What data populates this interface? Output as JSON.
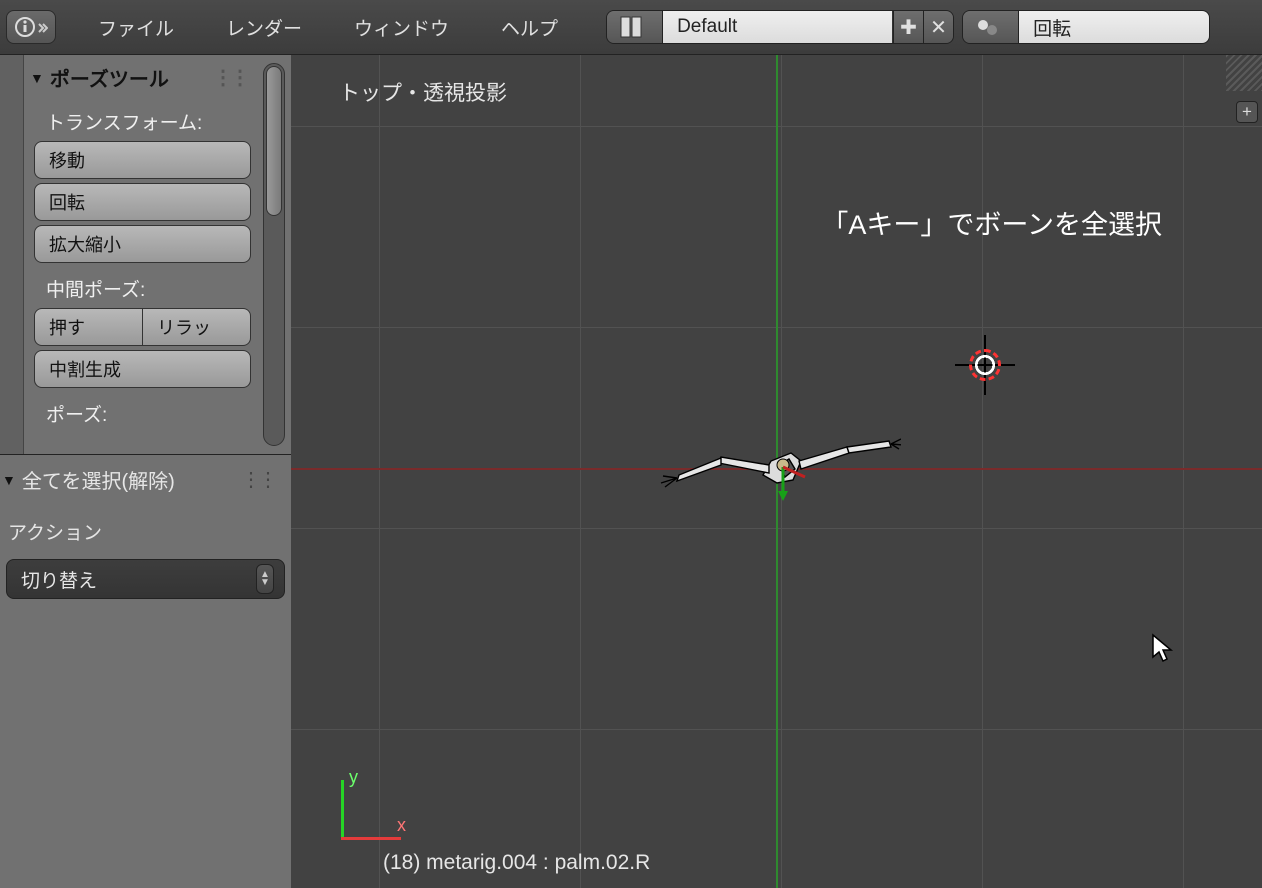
{
  "menu": {
    "file": "ファイル",
    "render": "レンダー",
    "window": "ウィンドウ",
    "help": "ヘルプ"
  },
  "layout_name": "Default",
  "scene_name": "回転",
  "tools": {
    "panel_title": "ポーズツール",
    "transform_label": "トランスフォーム:",
    "translate": "移動",
    "rotate": "回転",
    "scale": "拡大縮小",
    "inbetween_label": "中間ポーズ:",
    "push": "押す",
    "relax": "リラッ",
    "breakdown": "中割生成",
    "pose_label": "ポーズ:"
  },
  "operator_panel": {
    "title": "全てを選択(解除)",
    "action_label": "アクション",
    "action_value": "切り替え"
  },
  "viewport": {
    "projection": "トップ・透視投影",
    "annotation": "「Aキー」でボーンを全選択",
    "status": "(18) metarig.004 : palm.02.R",
    "axis_y": "y",
    "axis_x": "x"
  }
}
